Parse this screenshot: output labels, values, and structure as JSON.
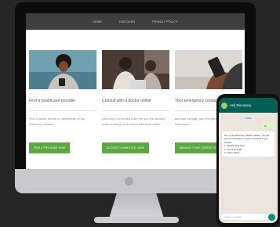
{
  "nav": {
    "items": [
      "HOME",
      "DISCOVER",
      "PRIVACY POLICY"
    ]
  },
  "cards": [
    {
      "title": "Find a healthcare provider",
      "text": "Find a doctor, dentist or optometrist on our Discovery network.",
      "button": "FIND A PROVIDER NOW"
    },
    {
      "title": "Consult with a doctor online",
      "text": "Discovery Connected Care lets you find doctors, make bookings and consult with them online.",
      "button": "ACCESS CONNECTED CARE"
    },
    {
      "title": "Your emergency contacts",
      "text": "Add and manage your emergency contact information.",
      "button": "MANAGE YOUR CONTACTS"
    }
  ],
  "phone": {
    "chat_name": "Ask Discovery",
    "date_label": "TODAY",
    "outgoing": "Hi",
    "reply": "Hi, I'm the Discovery Health chatbot. You can ask me a question or type a keyword to get started.",
    "options": [
      "1. Membership card",
      "2. Find a provider",
      "3. Claim status"
    ],
    "input_placeholder": "Type a message"
  },
  "colors": {
    "accent_green": "#5fa743",
    "nav_bg": "#3f3f3f",
    "whatsapp_header": "#075e54"
  }
}
